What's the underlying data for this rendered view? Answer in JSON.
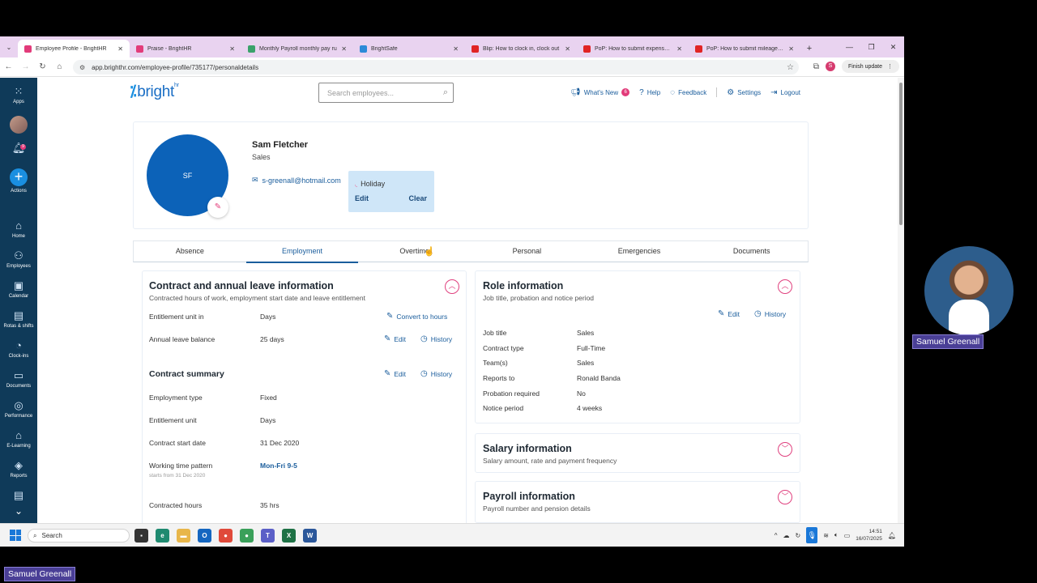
{
  "browser": {
    "tabs": [
      {
        "title": "Employee Profile - BrightHR",
        "favicon_color": "#e23b7a",
        "active": true
      },
      {
        "title": "Praise - BrightHR",
        "favicon_color": "#e23b7a",
        "active": false
      },
      {
        "title": "Monthly Payroll monthly pay ru",
        "favicon_color": "#3aa26b",
        "active": false
      },
      {
        "title": "BrightSafe",
        "favicon_color": "#2c8ad8",
        "active": false
      },
      {
        "title": "Blip: How to clock in, clock out",
        "favicon_color": "#e02424",
        "active": false
      },
      {
        "title": "PoP: How to submit expenses (",
        "favicon_color": "#e02424",
        "active": false
      },
      {
        "title": "PoP: How to submit mileage (U",
        "favicon_color": "#e02424",
        "active": false
      }
    ],
    "url": "app.brighthr.com/employee-profile/735177/personaldetails",
    "profile_initial": "S",
    "finish_update": "Finish update"
  },
  "rail": {
    "items": [
      {
        "label": "Apps",
        "icon": "apps-grid-icon"
      },
      {
        "label": "Actions",
        "icon": "plus-icon"
      },
      {
        "label": "Home",
        "icon": "home-icon"
      },
      {
        "label": "Employees",
        "icon": "people-icon"
      },
      {
        "label": "Calendar",
        "icon": "calendar-icon"
      },
      {
        "label": "Rotas & shifts",
        "icon": "rota-icon"
      },
      {
        "label": "Clock-ins",
        "icon": "clock-icon"
      },
      {
        "label": "Documents",
        "icon": "folder-icon"
      },
      {
        "label": "Performance",
        "icon": "target-icon"
      },
      {
        "label": "E-Learning",
        "icon": "graduation-icon"
      },
      {
        "label": "Reports",
        "icon": "layers-icon"
      }
    ],
    "notification_count": "9"
  },
  "header": {
    "logo": "bright",
    "logo_suffix": "hr",
    "search_placeholder": "Search employees...",
    "links": {
      "whats_new": "What's New",
      "whats_new_count": "6",
      "help": "Help",
      "feedback": "Feedback",
      "settings": "Settings",
      "logout": "Logout"
    }
  },
  "profile": {
    "initials": "SF",
    "name": "Sam Fletcher",
    "department": "Sales",
    "email": "s-greenall@hotmail.com",
    "popover": {
      "status": "Holiday",
      "edit": "Edit",
      "clear": "Clear"
    }
  },
  "tabs": [
    "Absence",
    "Employment",
    "Overtime",
    "Personal",
    "Emergencies",
    "Documents"
  ],
  "contract": {
    "title": "Contract and annual leave information",
    "subtitle": "Contracted hours of work, employment start date and leave entitlement",
    "rows": [
      {
        "label": "Entitlement unit in",
        "value": "Days"
      },
      {
        "label": "Annual leave balance",
        "value": "25 days"
      }
    ],
    "convert": "Convert to hours",
    "edit": "Edit",
    "history": "History",
    "summary_title": "Contract summary",
    "summary_rows": [
      {
        "label": "Employment type",
        "value": "Fixed"
      },
      {
        "label": "Entitlement unit",
        "value": "Days"
      },
      {
        "label": "Contract start date",
        "value": "31 Dec 2020"
      },
      {
        "label": "Working time pattern",
        "value": "Mon-Fri 9-5"
      },
      {
        "label": "Contracted hours",
        "value": "35 hrs"
      }
    ],
    "pattern_note": "starts from 31 Dec 2020"
  },
  "role": {
    "title": "Role information",
    "subtitle": "Job title, probation and notice period",
    "edit": "Edit",
    "history": "History",
    "rows": [
      {
        "label": "Job title",
        "value": "Sales"
      },
      {
        "label": "Contract type",
        "value": "Full-Time"
      },
      {
        "label": "Team(s)",
        "value": "Sales"
      },
      {
        "label": "Reports to",
        "value": "Ronald Banda"
      },
      {
        "label": "Probation required",
        "value": "No"
      },
      {
        "label": "Notice period",
        "value": "4 weeks"
      }
    ]
  },
  "salary": {
    "title": "Salary information",
    "subtitle": "Salary amount, rate and payment frequency"
  },
  "payroll": {
    "title": "Payroll information",
    "subtitle": "Payroll number and pension details"
  },
  "taskbar": {
    "search": "Search",
    "time": "14:51",
    "date": "16/07/2025"
  },
  "presenter": {
    "name": "Samuel Greenall",
    "brand": "bright"
  }
}
